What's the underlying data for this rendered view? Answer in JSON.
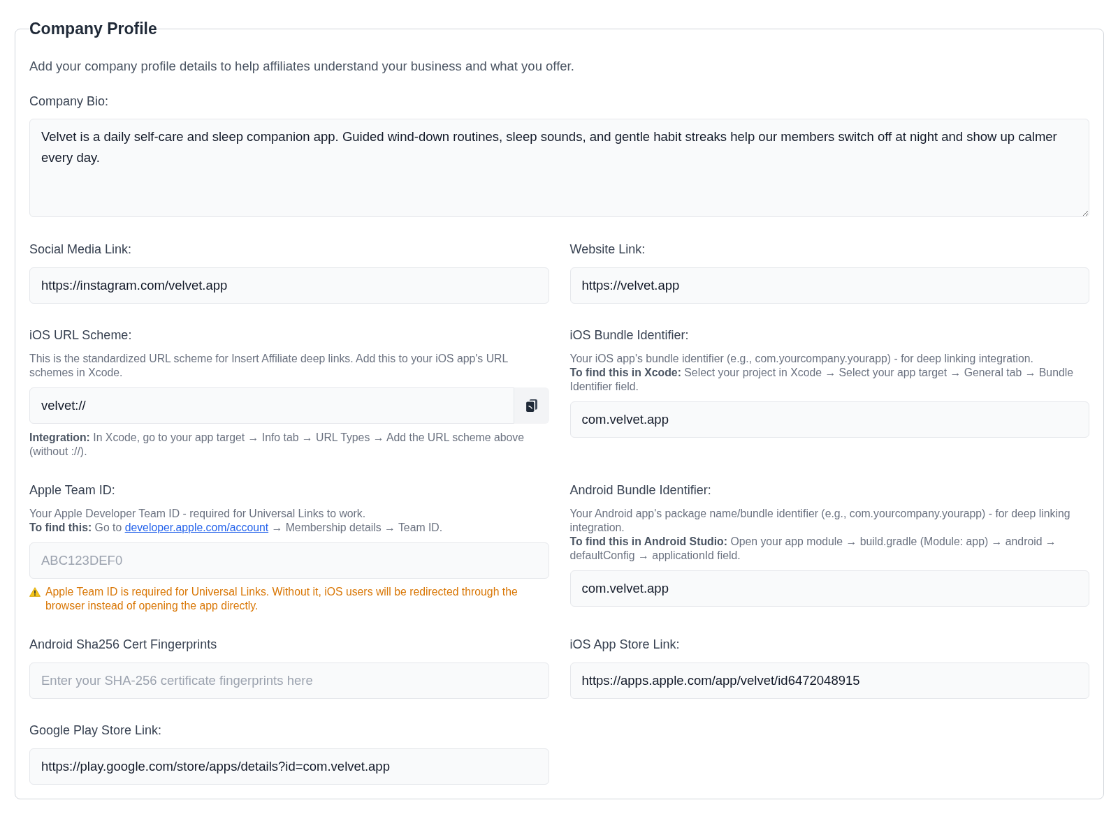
{
  "profile": {
    "title": "Company Profile",
    "description": "Add your company profile details to help affiliates understand your business and what you offer.",
    "bio": {
      "label": "Company Bio:",
      "value": "Velvet is a daily self-care and sleep companion app. Guided wind-down routines, sleep sounds, and gentle habit streaks help our members switch off at night and show up calmer every day."
    },
    "fields": [
      {
        "kind": "input",
        "label": "Social Media Link:",
        "value": "https://instagram.com/velvet.app"
      },
      {
        "kind": "input",
        "label": "Website Link:",
        "value": "https://velvet.app"
      },
      {
        "kind": "copy_input",
        "label": "iOS URL Scheme:",
        "help": [
          {
            "text": "This is the standardized URL scheme for Insert Affiliate deep links. Add this to your iOS app's URL schemes in Xcode."
          }
        ],
        "value": "velvet://",
        "notes": [
          {
            "kind": "info",
            "text": "**Integration:** In Xcode, go to your app target → Info tab → URL Types → Add the URL scheme above (without ://)."
          }
        ]
      },
      {
        "kind": "input",
        "label": "iOS Bundle Identifier:",
        "help": [
          {
            "text": "Your iOS app's bundle identifier (e.g., com.yourcompany.yourapp) - for deep linking integration."
          },
          {
            "text": "**To find this in Xcode:** Select your project in Xcode → Select your app target → General tab → Bundle Identifier field."
          }
        ],
        "value": "com.velvet.app"
      },
      {
        "kind": "input",
        "label": "Apple Team ID:",
        "help": [
          {
            "text": "Your Apple Developer Team ID - required for Universal Links to work."
          },
          {
            "text": "**To find this:** Go to",
            "link": "developer.apple.com/account",
            "text_after": "→ Membership details → Team ID."
          }
        ],
        "placeholder": "ABC123DEF0",
        "notes": [
          {
            "kind": "warning",
            "text": "Apple Team ID is required for Universal Links. Without it, iOS users will be redirected through the browser instead of opening the app directly."
          }
        ]
      },
      {
        "kind": "input",
        "label": "Android Bundle Identifier:",
        "help": [
          {
            "text": "Your Android app's package name/bundle identifier (e.g., com.yourcompany.yourapp) - for deep linking integration."
          },
          {
            "text": "**To find this in Android Studio:** Open your app module → build.gradle (Module: app) → android → defaultConfig → applicationId field."
          }
        ],
        "value": "com.velvet.app"
      },
      {
        "kind": "input",
        "label": "Android Sha256 Cert Fingerprints",
        "placeholder": "Enter your SHA-256 certificate fingerprints here"
      },
      {
        "kind": "input",
        "label": "iOS App Store Link:",
        "value": "https://apps.apple.com/app/velvet/id6472048915"
      },
      {
        "kind": "input",
        "label": "Google Play Store Link:",
        "value": "https://play.google.com/store/apps/details?id=com.velvet.app"
      }
    ]
  }
}
